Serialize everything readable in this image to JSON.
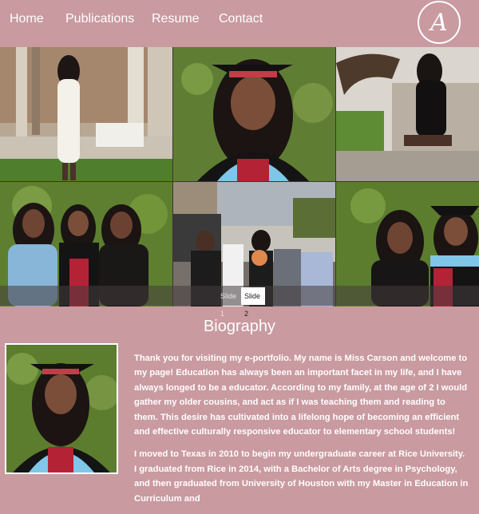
{
  "nav": {
    "items": [
      {
        "label": "Home"
      },
      {
        "label": "Publications"
      },
      {
        "label": "Resume"
      },
      {
        "label": "Contact"
      }
    ],
    "logo_letter": "A"
  },
  "slideshow": {
    "buttons": [
      {
        "label": "Slide 1",
        "active": false
      },
      {
        "label": "Slide 2",
        "active": true
      }
    ]
  },
  "biography": {
    "heading": "Biography",
    "paragraphs": [
      "Thank you for visiting my e-portfolio. My name is Miss Carson and welcome to my page! Education has always been an important facet in my life, and I have always longed to be a educator. According to my family, at the age of 2 I would gather my older cousins, and act as if I was teaching them and reading to them. This desire has cultivated into a lifelong hope of becoming an efficient and effective culturally responsive educator to elementary school students!",
      "I moved to Texas in 2010 to begin my undergraduate career at Rice University. I graduated from Rice in 2014, with a Bachelor of Arts degree in Psychology, and then graduated from University of Houston with my Master in Education in Curriculum and"
    ]
  },
  "colors": {
    "background": "#c99aa0",
    "text": "#ffffff",
    "slide_bar": "#463c3e"
  }
}
